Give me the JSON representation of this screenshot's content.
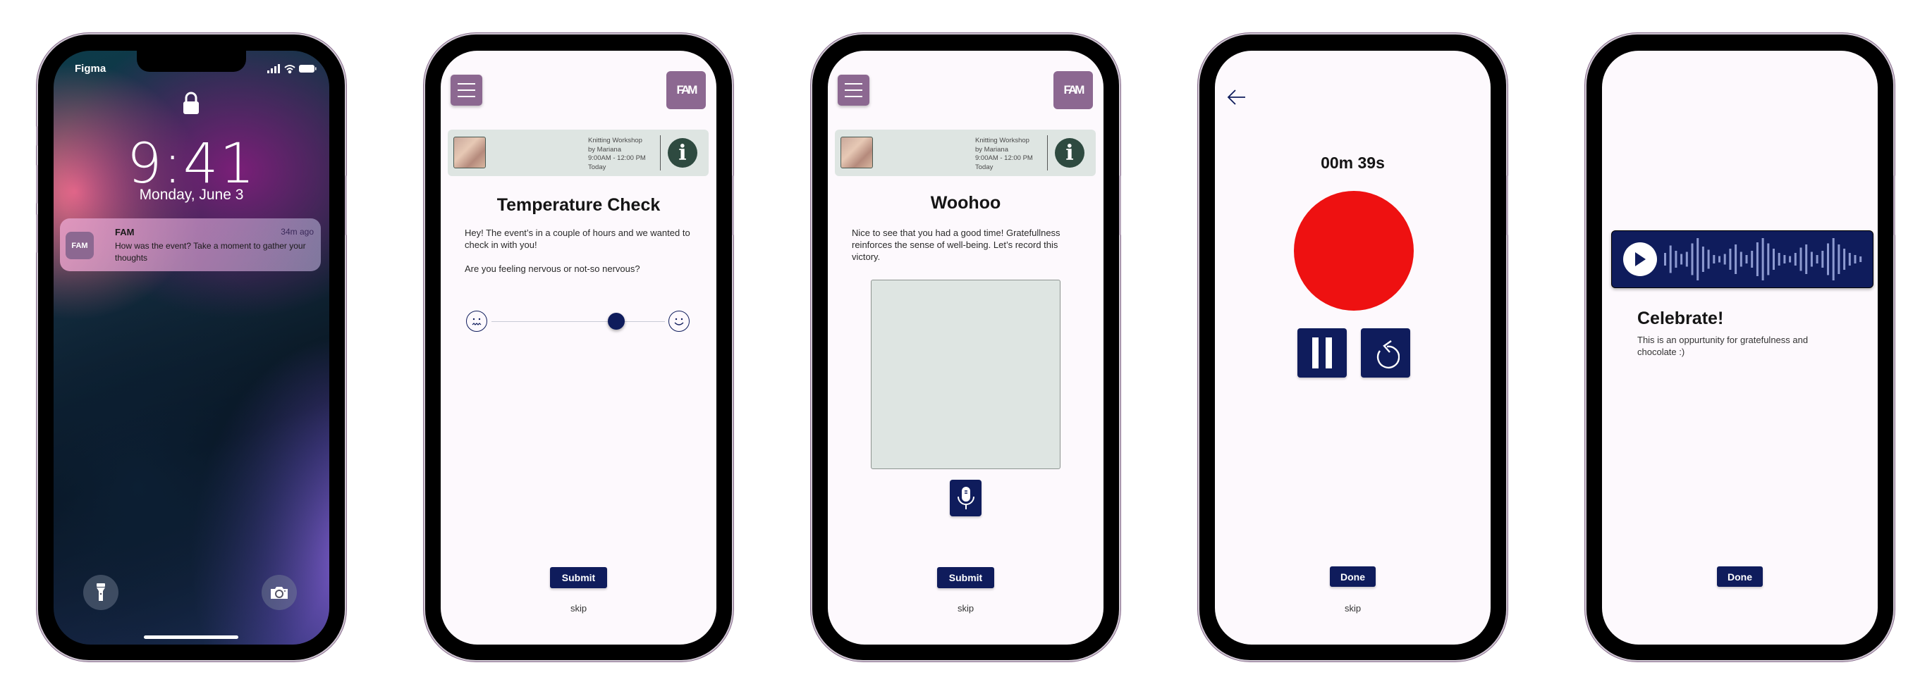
{
  "lock_screen": {
    "carrier": "Figma",
    "time": "9:41",
    "date": "Monday, June 3",
    "notification": {
      "app": "FAM",
      "time_ago": "34m ago",
      "message": "How was the event? Take a moment to gather your thoughts",
      "icon_text": "FAM"
    }
  },
  "app": {
    "logo_text": "FAM",
    "event": {
      "title": "Knitting Workshop",
      "host": "by Mariana",
      "time": "9:00AM - 12:00 PM",
      "day": "Today"
    },
    "info_glyph": "i"
  },
  "temperature_check": {
    "title": "Temperature Check",
    "body1": "Hey! The event’s in a couple of hours and we wanted to check in with you!",
    "body2": "Are you feeling nervous or not-so nervous?",
    "slider_value": 0.72,
    "submit": "Submit",
    "skip": "skip"
  },
  "woohoo": {
    "title": "Woohoo",
    "body": "Nice to see that you had a good time! Gratefullness reinforces the sense of well-being. Let’s record this victory.",
    "note_value": "",
    "submit": "Submit",
    "skip": "skip"
  },
  "recording": {
    "timer": "00m 39s",
    "done": "Done",
    "skip": "skip"
  },
  "celebrate": {
    "title": "Celebrate!",
    "body": "This is an oppurtunity for gratefulness and chocolate :)",
    "done": "Done"
  },
  "colors": {
    "brand_purple": "#8c6891",
    "navy": "#0f1c5c",
    "record_red": "#ee1111",
    "card_bg": "#dee5e2"
  }
}
